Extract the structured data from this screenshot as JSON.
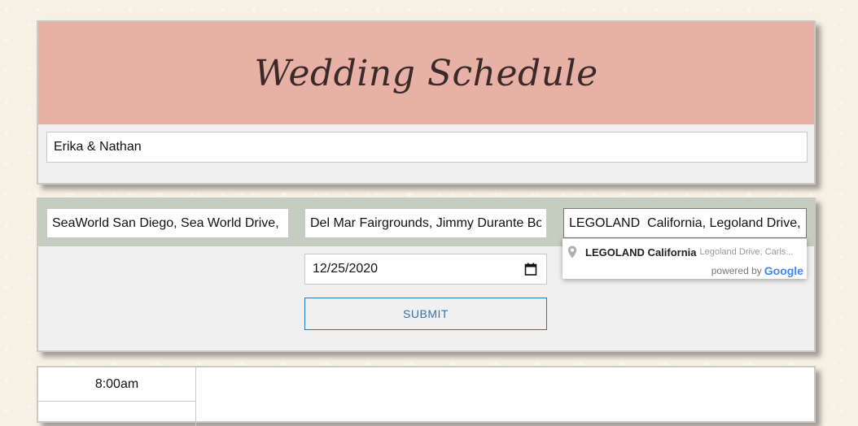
{
  "header": {
    "title": "Wedding Schedule",
    "names_value": "Erika & Nathan"
  },
  "form": {
    "locations": [
      "SeaWorld San Diego, Sea World Drive, San Diego, CA, USA",
      "Del Mar Fairgrounds, Jimmy Durante Boulevard, Del Mar, CA, USA",
      "LEGOLAND  California, Legoland Drive, Carlsbad, CA, USA"
    ],
    "date_display": "12/25/2020",
    "submit_label": "SUBMIT"
  },
  "autocomplete": {
    "main_text": "LEGOLAND California",
    "secondary_text": "Legoland Drive, Carls...",
    "powered_by": "powered by",
    "google": "Google"
  },
  "schedule": {
    "rows": [
      {
        "time": "8:00am"
      }
    ]
  },
  "colors": {
    "title_band": "#e8b1a5",
    "location_band": "#c4cdbf",
    "accent": "#2f74b5"
  }
}
